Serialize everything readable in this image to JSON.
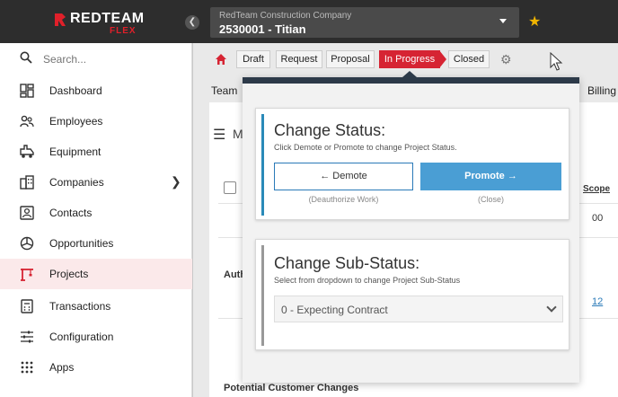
{
  "app": {
    "logo_text": "REDTEAM",
    "logo_sub": "FLEX",
    "company_name": "RedTeam Construction Company",
    "project": "2530001 - Titian",
    "accent_color": "#d62433"
  },
  "sidebar": {
    "search_placeholder": "Search...",
    "items": [
      {
        "label": "Dashboard",
        "icon": "dashboard-icon"
      },
      {
        "label": "Employees",
        "icon": "people-icon"
      },
      {
        "label": "Equipment",
        "icon": "truck-icon"
      },
      {
        "label": "Companies",
        "icon": "building-icon"
      },
      {
        "label": "Contacts",
        "icon": "contact-card-icon"
      },
      {
        "label": "Opportunities",
        "icon": "pie-icon"
      },
      {
        "label": "Projects",
        "icon": "crane-icon"
      },
      {
        "label": "Transactions",
        "icon": "calculator-icon"
      },
      {
        "label": "Configuration",
        "icon": "sliders-icon"
      },
      {
        "label": "Apps",
        "icon": "grid-icon"
      }
    ]
  },
  "status_steps": {
    "draft": "Draft",
    "request": "Request",
    "proposal": "Proposal",
    "in_progress": "In Progress",
    "closed": "Closed"
  },
  "tabs": {
    "team": "Team",
    "billing": "Billing"
  },
  "content": {
    "menu_letter": "M",
    "scope_label": "Scope",
    "scope_value": "00",
    "auth_label": "Auth",
    "link_value": "12",
    "potential_changes": "Potential Customer Changes"
  },
  "change_status": {
    "title": "Change Status:",
    "subtitle": "Click Demote or Promote to change Project Status.",
    "demote_label": "← Demote",
    "demote_note": "(Deauthorize Work)",
    "promote_label": "Promote →",
    "promote_note": "(Close)"
  },
  "change_substatus": {
    "title": "Change Sub-Status:",
    "subtitle": "Select from dropdown to change Project Sub-Status",
    "selected": "0 - Expecting Contract"
  }
}
